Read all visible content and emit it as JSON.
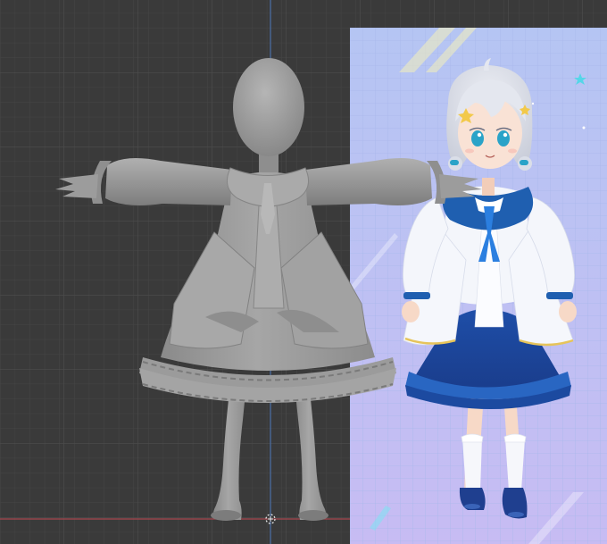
{
  "viewport": {
    "background_color": "#3a3a3a",
    "grid_minor_color": "#444444",
    "grid_major_color": "#4b4b4b",
    "y_axis_color": "#4c6fa8",
    "x_axis_color": "#a8474f",
    "origin_marker_color": "#e8e8e8"
  },
  "model": {
    "mesh_color": "#9a9a9a",
    "mesh_shadow_color": "#6e6e6e",
    "mesh_highlight_color": "#bdbdbd"
  },
  "reference": {
    "background_top": "#b8c7f4",
    "background_bottom": "#c6bdf2",
    "hair_color": "#d8dce6",
    "eye_color": "#2aa3c8",
    "blouse_color": "#f4f6fb",
    "collar_color": "#1f5fb0",
    "skirt_color": "#1d4fa8",
    "trim_color": "#e6c45a",
    "shoe_color": "#1f3f8f",
    "accent_star_color": "#55d6e8"
  }
}
